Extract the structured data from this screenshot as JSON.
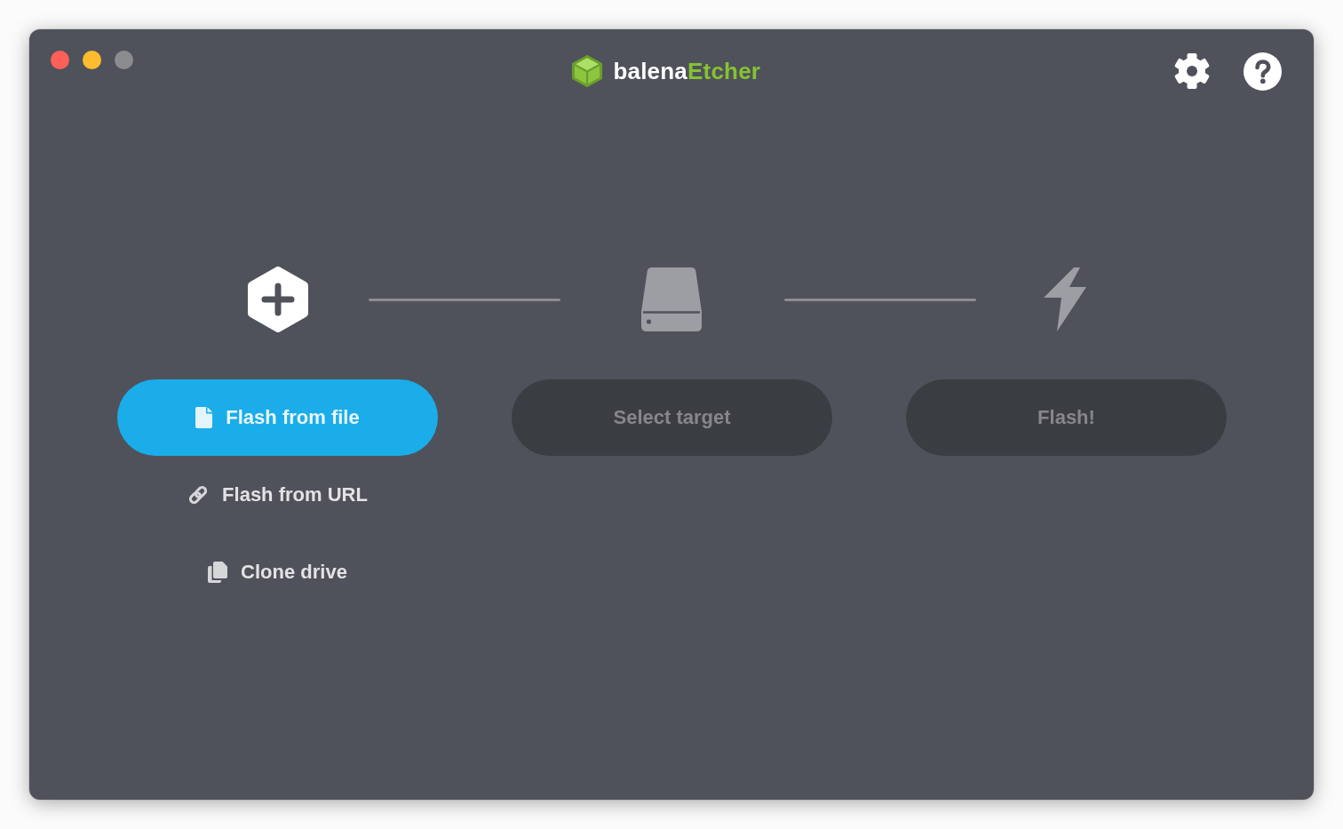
{
  "window": {
    "controls": [
      {
        "kind": "close",
        "disabled": false
      },
      {
        "kind": "minimize",
        "disabled": false
      },
      {
        "kind": "zoom",
        "disabled": true
      }
    ]
  },
  "header": {
    "logo": [
      "balena",
      "Etcher"
    ],
    "actions": [
      {
        "kind": "settings"
      },
      {
        "kind": "help"
      }
    ]
  },
  "steps": [
    {
      "kind": "source",
      "disabled": false,
      "button": "Flash from file",
      "options": [
        {
          "kind": "url",
          "label": "Flash from URL"
        },
        {
          "kind": "clone",
          "label": "Clone drive"
        }
      ]
    },
    {
      "kind": "target",
      "disabled": true,
      "button": "Select target"
    },
    {
      "kind": "flash",
      "disabled": true,
      "button": "Flash!"
    }
  ]
}
